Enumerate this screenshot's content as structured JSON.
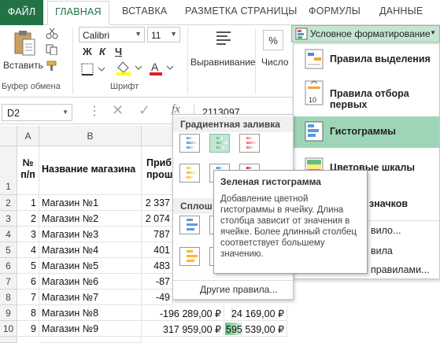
{
  "tabs": [
    "ФАЙЛ",
    "ГЛАВНАЯ",
    "ВСТАВКА",
    "РАЗМЕТКА СТРАНИЦЫ",
    "ФОРМУЛЫ",
    "ДАННЫЕ"
  ],
  "ribbon": {
    "paste_label": "Вставить",
    "clipboard_group": "Буфер обмена",
    "font_name": "Calibri",
    "font_size": "11",
    "bold": "Ж",
    "italic": "К",
    "underline": "Ч",
    "font_group": "Шрифт",
    "alignment_label": "Выравнивание",
    "number_label": "Число",
    "percent": "%",
    "cf_button": "Условное форматирование"
  },
  "formula_bar": {
    "name_box": "D2",
    "fx": "fx",
    "value": "2113097"
  },
  "columns": [
    "A",
    "B"
  ],
  "row_numbers": [
    "1",
    "2",
    "3",
    "4",
    "5",
    "6",
    "7",
    "8",
    "9",
    "10"
  ],
  "header_row": {
    "num_label": "№\nп/п",
    "name_label": "Название магазина",
    "profit_label": "Приб\nпрошл"
  },
  "rows": [
    {
      "n": "1",
      "name": "Магазин №1",
      "c": "2 337"
    },
    {
      "n": "2",
      "name": "Магазин №2",
      "c": "2 074"
    },
    {
      "n": "3",
      "name": "Магазин №3",
      "c": "787"
    },
    {
      "n": "4",
      "name": "Магазин №4",
      "c": "401"
    },
    {
      "n": "5",
      "name": "Магазин №5",
      "c": "483"
    },
    {
      "n": "6",
      "name": "Магазин №6",
      "c": "-87"
    },
    {
      "n": "7",
      "name": "Магазин №7",
      "c": "-49"
    },
    {
      "n": "8",
      "name": "Магазин №8",
      "c": "-196 289,00 ₽",
      "d": "224 169,00 ₽"
    },
    {
      "n": "9",
      "name": "Магазин №9",
      "c": "317 959,00 ₽",
      "d": "595 539,00 ₽"
    }
  ],
  "cf_menu": {
    "items": [
      {
        "label": "Правила выделения"
      },
      {
        "label": "Правила отбора первых"
      },
      {
        "label": "Гистограммы"
      },
      {
        "label": "Цветовые шкалы"
      },
      {
        "label": "значков"
      },
      {
        "label": "вило..."
      },
      {
        "label": "вила"
      },
      {
        "label": "правилами..."
      }
    ]
  },
  "gallery": {
    "gradient_header": "Градиентная заливка",
    "solid_header": "Сплош",
    "more_rules": "Другие правила..."
  },
  "tooltip": {
    "title": "Зеленая гистограмма",
    "body": "Добавление цветной гистограммы в ячейку. Длина столбца зависит от значения в ячейке. Более длинный столбец соответствует большему значению."
  },
  "colors": {
    "excel_green": "#217346",
    "highlight": "#9fd5b7",
    "bar_blue": "#5b9bd5",
    "bar_green": "#63be7b",
    "bar_red": "#f8696b",
    "bar_orange": "#ffb628",
    "bar_lightblue": "#008aef",
    "bar_purple": "#d6007b"
  }
}
